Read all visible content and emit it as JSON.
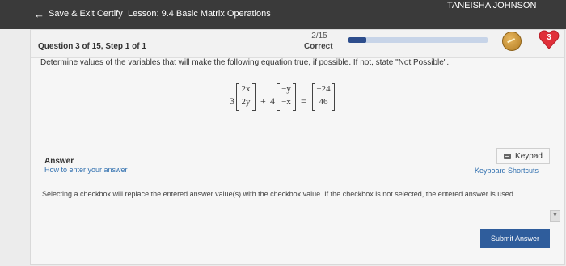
{
  "topbar": {
    "back_label": "Save & Exit Certify",
    "lesson": "Lesson: 9.4 Basic Matrix Operations",
    "user_name": "TANEISHA JOHNSON"
  },
  "question": {
    "title": "Question 3 of 15, Step 1 of 1",
    "progress_text": "2/15",
    "status": "Correct",
    "progress_fraction": 0.13,
    "streak_count": "3",
    "prompt": "Determine values of the variables that will make the following equation true, if possible. If not, state \"Not Possible\".",
    "equation": {
      "scalar1": "3",
      "matrix1": [
        "2x",
        "2y"
      ],
      "plus": "+",
      "scalar2": "4",
      "matrix2": [
        "−y",
        "−x"
      ],
      "equals": "=",
      "matrix3": [
        "−24",
        "46"
      ]
    }
  },
  "answer": {
    "label": "Answer",
    "how_link": "How to enter your answer",
    "keypad_label": "Keypad",
    "shortcuts_link": "Keyboard Shortcuts",
    "note": "Selecting a checkbox will replace the entered answer value(s) with the checkbox value. If the checkbox is not selected, the entered answer is used."
  },
  "submit_label": "Submit Answer",
  "colors": {
    "accent": "#2f5d9c",
    "link": "#2f6faf",
    "heart": "#e0303a",
    "topbar": "#3a3a3a"
  },
  "icons": [
    "back-arrow-icon",
    "coin-icon",
    "heart-icon",
    "keypad-icon",
    "scroll-down-icon"
  ]
}
